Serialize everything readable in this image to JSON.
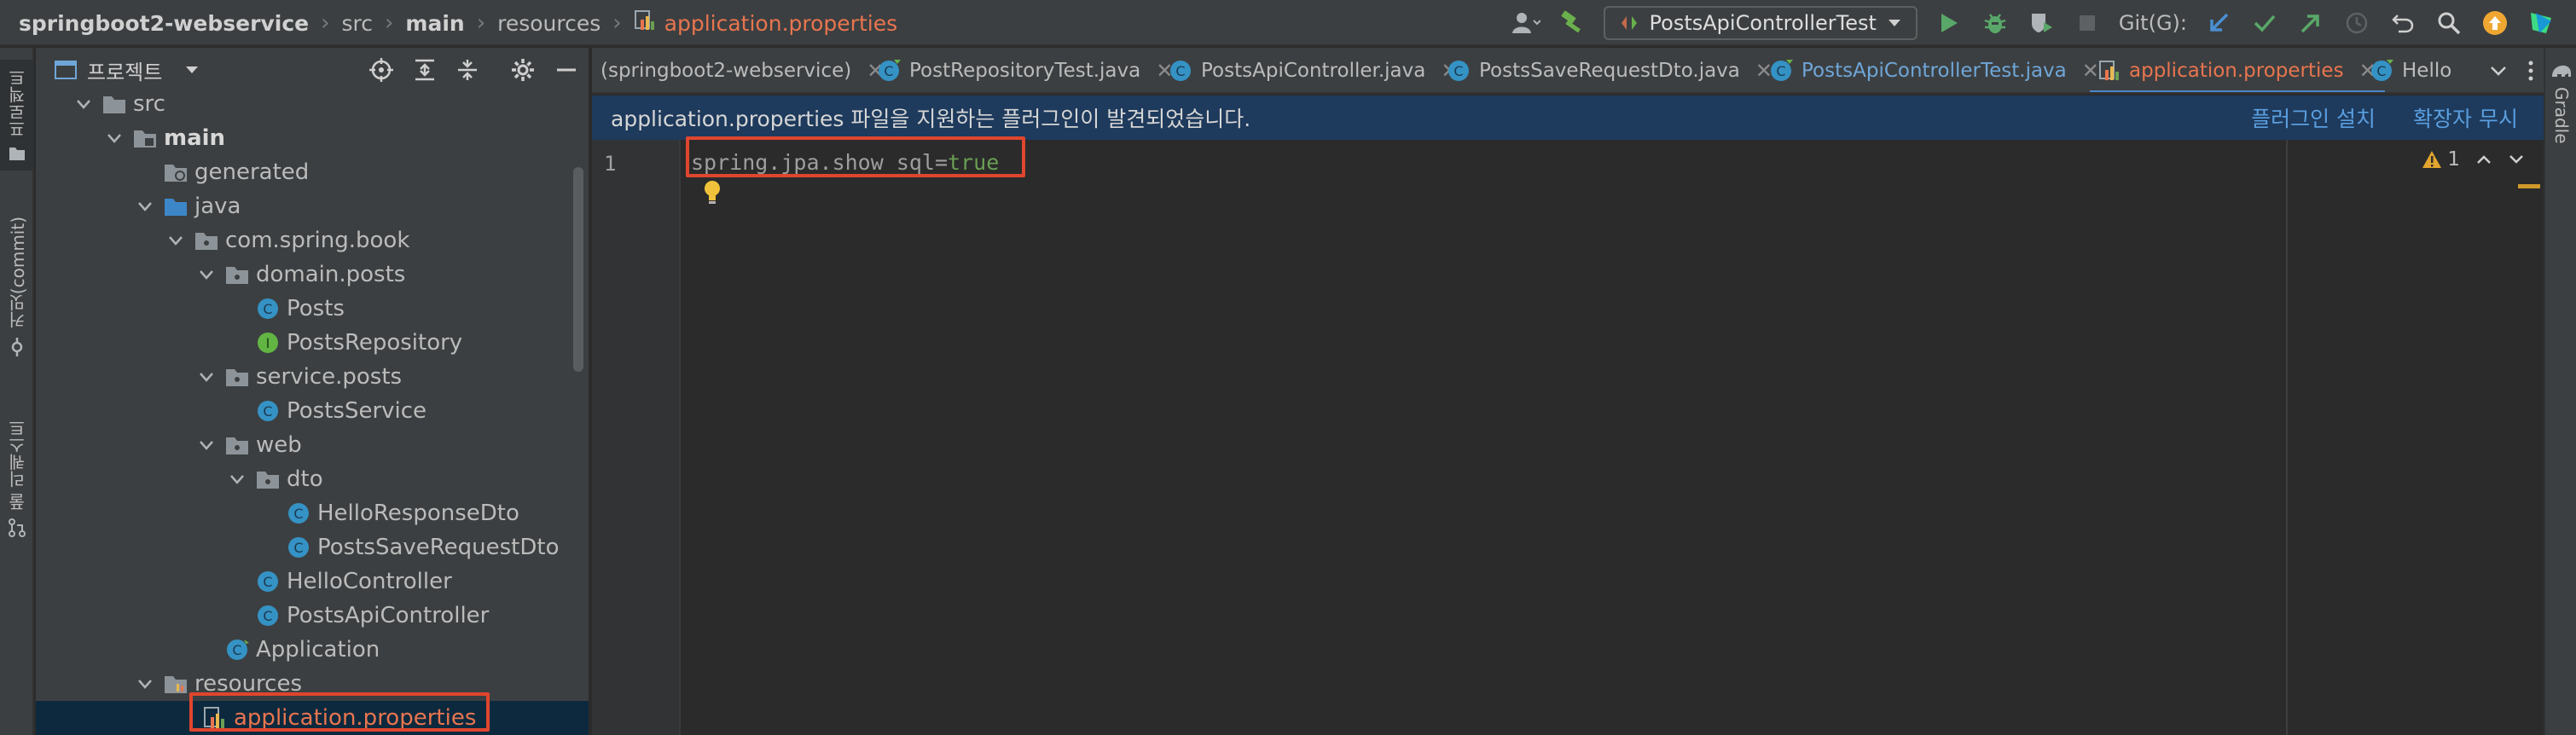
{
  "breadcrumb": {
    "project": "springboot2-webservice",
    "items": [
      "src",
      "main",
      "resources"
    ],
    "current_file": "application.properties"
  },
  "toolbar": {
    "run_config": "PostsApiControllerTest",
    "git_label": "Git(G):"
  },
  "left_strip": {
    "project_tab": "프로젝트",
    "commit_tab": "커밋(commit)",
    "pull_requests_tab": "풀 리퀘스트"
  },
  "right_strip": {
    "gradle_tab": "Gradle"
  },
  "project_panel": {
    "title": "프로젝트"
  },
  "tree": {
    "src": "src",
    "main": "main",
    "generated": "generated",
    "java": "java",
    "com_spring_book": "com.spring.book",
    "domain_posts": "domain.posts",
    "posts": "Posts",
    "posts_repository": "PostsRepository",
    "service_posts": "service.posts",
    "posts_service": "PostsService",
    "web": "web",
    "dto": "dto",
    "hello_response_dto": "HelloResponseDto",
    "posts_save_request_dto": "PostsSaveRequestDto",
    "hello_controller": "HelloController",
    "posts_api_controller": "PostsApiController",
    "application": "Application",
    "resources": "resources",
    "application_properties": "application.properties"
  },
  "tabs": [
    {
      "label": "(springboot2-webservice)"
    },
    {
      "label": "PostRepositoryTest.java"
    },
    {
      "label": "PostsApiController.java"
    },
    {
      "label": "PostsSaveRequestDto.java"
    },
    {
      "label": "PostsApiControllerTest.java"
    },
    {
      "label": "application.properties"
    },
    {
      "label": "Hello"
    }
  ],
  "banner": {
    "message": "application.properties 파일을 지원하는 플러그인이 발견되었습니다.",
    "install_plugin": "플러그인 설치",
    "ignore_extension": "확장자 무시"
  },
  "editor": {
    "line_number": "1",
    "code_key": "spring.jpa.show_sql",
    "code_eq": "=",
    "code_value": "true",
    "warning_count": "1"
  },
  "colors": {
    "highlight": "#e0452e",
    "active_file": "#e8754f",
    "link": "#5a9fe0",
    "banner_bg": "#1e3a5c"
  }
}
